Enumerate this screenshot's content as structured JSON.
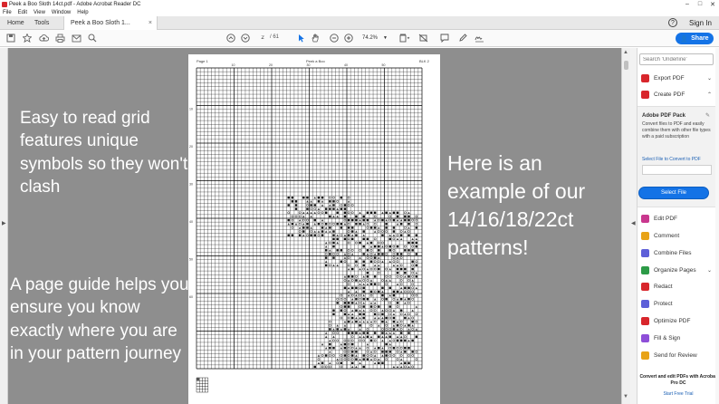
{
  "window": {
    "title": "Peek a Boo Sloth 14ct.pdf - Adobe Acrobat Reader DC",
    "controls": [
      "–",
      "□",
      "✕"
    ]
  },
  "menu": [
    "File",
    "Edit",
    "View",
    "Window",
    "Help"
  ],
  "tabs": {
    "home": "Home",
    "tools": "Tools",
    "document": "Peek a Boo Sloth 1...",
    "document_close": "×"
  },
  "header": {
    "signin": "Sign In",
    "help_glyph": "?"
  },
  "toolbar": {
    "page_current": "2",
    "page_total": "/ 61",
    "zoom": "74.2%",
    "share": "Share"
  },
  "overlay": {
    "text1": "Easy to read grid features unique symbols so they won't clash",
    "text2": "A page guide helps you ensure you know exactly where you are in your pattern journey",
    "text3": "Here is an example of our 14/16/18/22ct patterns!"
  },
  "pdf_page": {
    "header_left": "Page 1",
    "header_center": "Peek a Boo",
    "header_right": "BLK 2",
    "col_labels": [
      "10",
      "20",
      "30",
      "40",
      "50"
    ],
    "row_labels": [
      "10",
      "20",
      "30",
      "40",
      "50",
      "60"
    ]
  },
  "right_panel": {
    "search_placeholder": "Search 'Underline'",
    "export_pdf": "Export PDF",
    "create_pdf": "Create PDF",
    "pack_title": "Adobe PDF Pack",
    "pack_desc": "Convert files to PDF and easily combine them with other file types with a paid subscription",
    "pack_link": "Select File to Convert to PDF",
    "select_file": "Select File",
    "tools": [
      "Edit PDF",
      "Comment",
      "Combine Files",
      "Organize Pages",
      "Redact",
      "Protect",
      "Optimize PDF",
      "Fill & Sign",
      "Send for Review"
    ],
    "promo": "Convert and edit PDFs with Acrobat Pro DC",
    "promo_link": "Start Free Trial"
  },
  "colors": {
    "accent": "#1473e6",
    "doc_background": "#8e8e8e",
    "export_icon": "#d8262c",
    "create_icon": "#d8262c",
    "edit_icon": "#c9378e",
    "comment_icon": "#e8a317",
    "combine_icon": "#5d5fd8",
    "organize_icon": "#2d9b47",
    "redact_icon": "#d8262c",
    "protect_icon": "#5d5fd8",
    "optimize_icon": "#d8262c",
    "fill_icon": "#8e4fd8",
    "review_icon": "#e8a317"
  }
}
